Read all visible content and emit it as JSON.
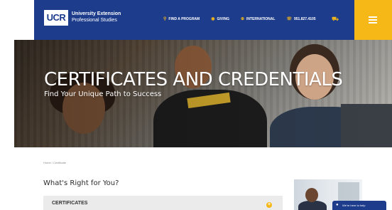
{
  "header": {
    "logo_mark": "UCR",
    "logo_line1": "University Extension",
    "logo_line2": "Professional Studies",
    "nav": [
      {
        "icon": "search-icon",
        "glyph": "⚲",
        "label": "FIND A PROGRAM"
      },
      {
        "icon": "giving-icon",
        "glyph": "◉",
        "label": "GIVING"
      },
      {
        "icon": "globe-icon",
        "glyph": "⊕",
        "label": "INTERNATIONAL"
      },
      {
        "icon": "phone-icon",
        "glyph": "☏",
        "label": "951.827.4105"
      }
    ],
    "cart_glyph": "⛟",
    "colors": {
      "primary": "#1d3c8c",
      "accent": "#f5b816"
    }
  },
  "hero": {
    "title": "CERTIFICATES AND CREDENTIALS",
    "subtitle": "Find Your Unique Path to Success"
  },
  "breadcrumb": "Home / Certificate",
  "section_title": "What's Right for You?",
  "accordion": {
    "label": "CERTIFICATES",
    "toggle_glyph": "+"
  },
  "chat": {
    "glyph": "●",
    "label": "We're here to help"
  }
}
